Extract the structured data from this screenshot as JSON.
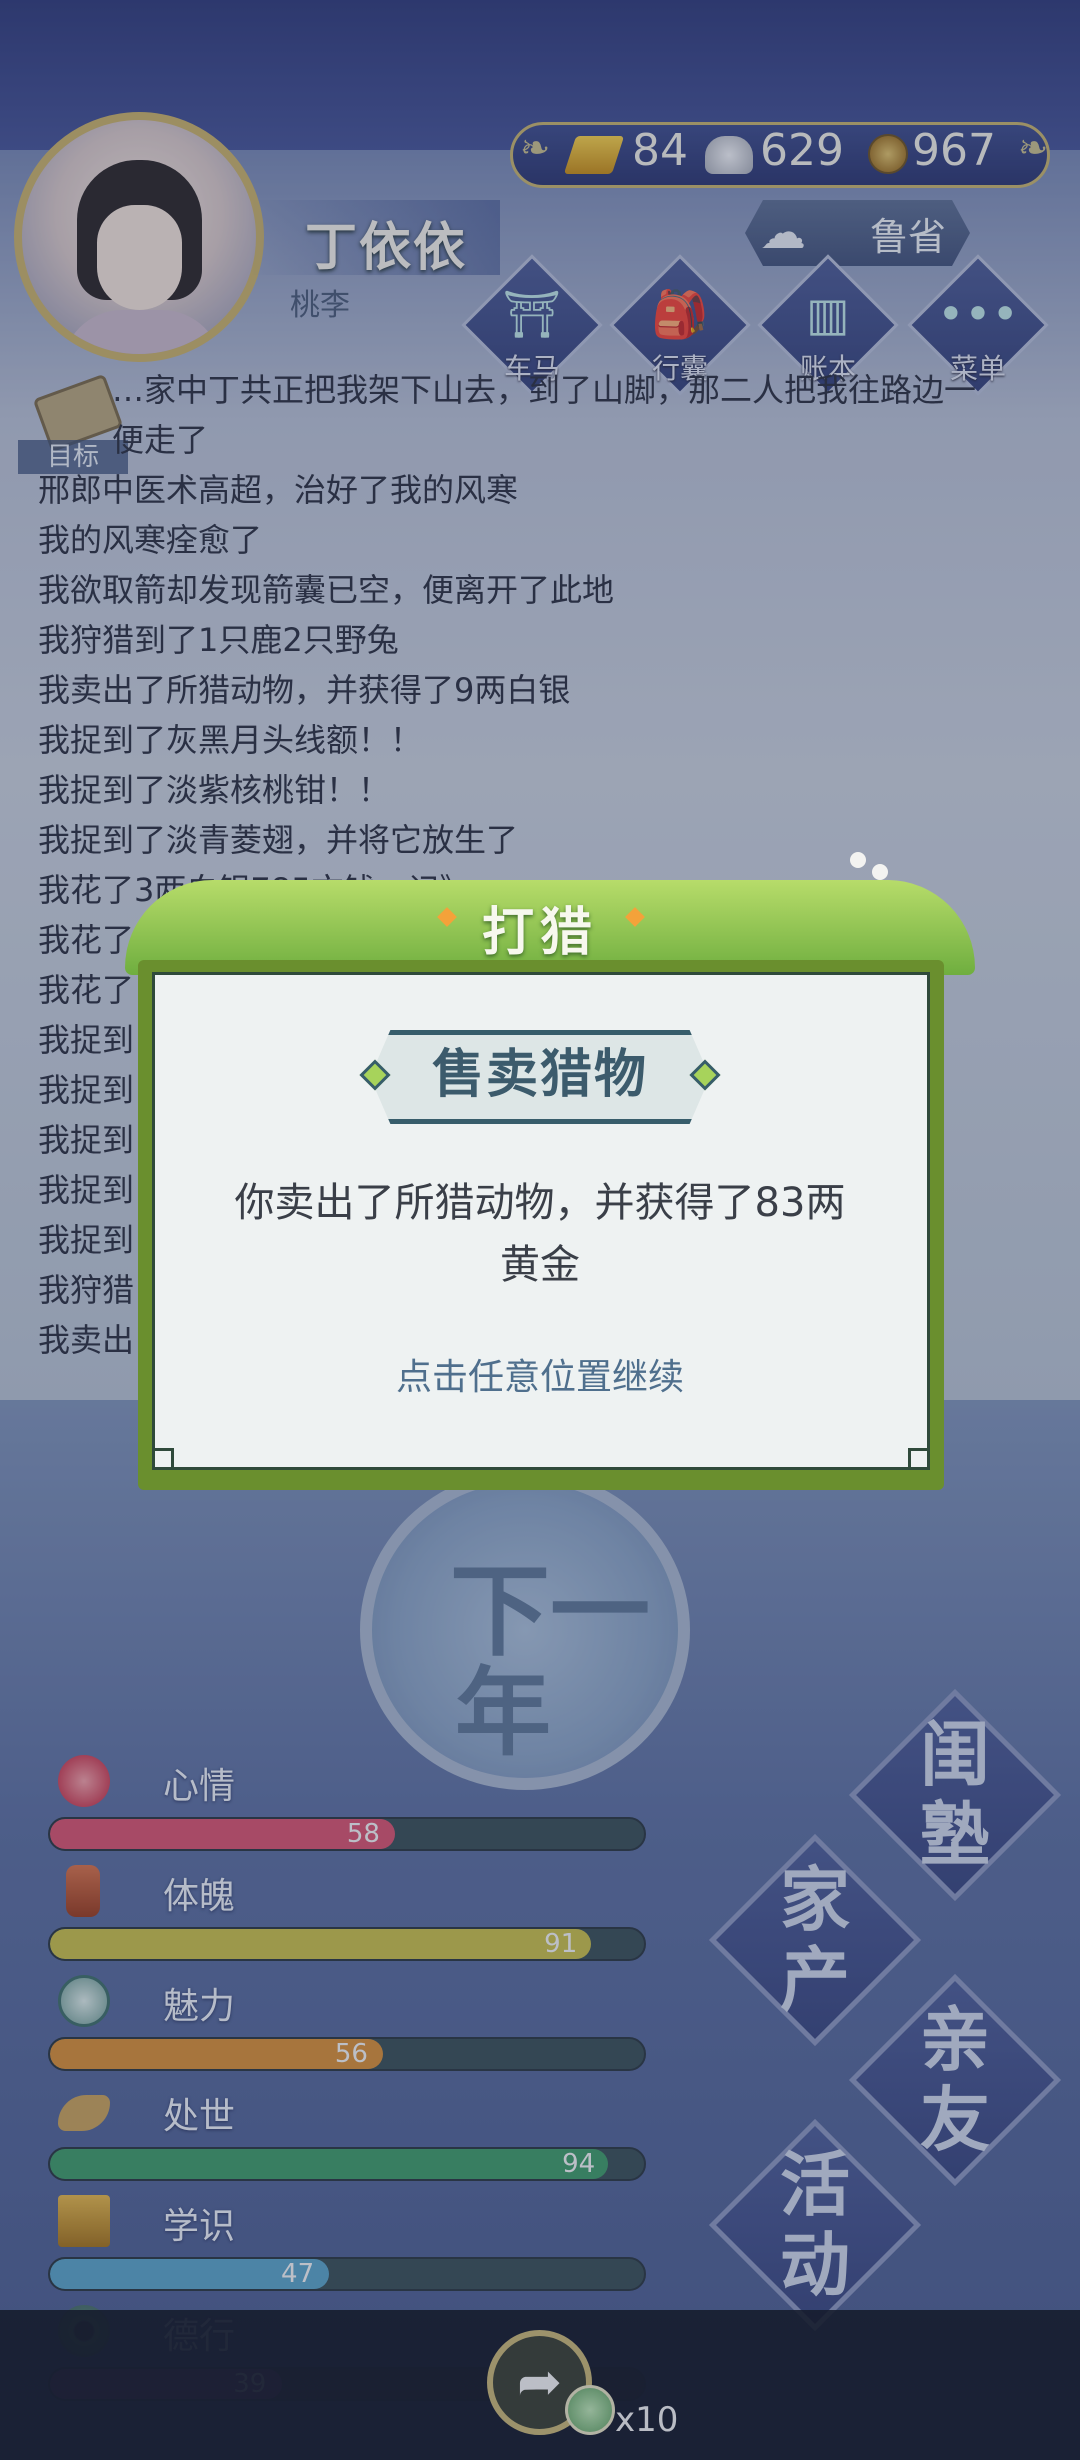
{
  "player": {
    "name": "丁依依",
    "subtitle": "桃李"
  },
  "currency": {
    "gold": "84",
    "silver": "629",
    "coins": "967"
  },
  "reflect_button": {
    "label": "鲁省"
  },
  "top_menu": [
    {
      "label": "车马",
      "icon": "carriage-icon"
    },
    {
      "label": "行囊",
      "icon": "bag-icon"
    },
    {
      "label": "账本",
      "icon": "ledger-icon"
    },
    {
      "label": "菜单",
      "icon": "menu-dots-icon"
    }
  ],
  "target": {
    "label": "目标"
  },
  "event_log": [
    "…家中丁共正把我架下山去，到了山脚，那二人把我往路边一",
    "便走了",
    "邢郎中医术高超，治好了我的风寒",
    "我的风寒痊愈了",
    "我欲取箭却发现箭囊已空，便离开了此地",
    "我狩猎到了1只鹿2只野兔",
    "我卖出了所猎动物，并获得了9两白银",
    "我捉到了灰黑月头线额！！",
    "我捉到了淡紫核桃钳！！",
    "我捉到了淡青菱翅，并将它放生了",
    "我花了3两白银785文钱…记》",
    "我花了",
    "我花了",
    "我捉到",
    "我捉到",
    "我捉到",
    "我捉到",
    "我捉到",
    "我狩猎",
    "我卖出"
  ],
  "next_year": {
    "line1": "下一",
    "line2": "年"
  },
  "stats": [
    {
      "name": "心情",
      "value": 58,
      "max": 100,
      "color": "#d9546f",
      "icon": "flower-icon"
    },
    {
      "name": "体魄",
      "value": 91,
      "max": 100,
      "color": "#c9c04a",
      "icon": "strength-icon"
    },
    {
      "name": "魅力",
      "value": 56,
      "max": 100,
      "color": "#d98f36",
      "icon": "mirror-icon"
    },
    {
      "name": "处世",
      "value": 94,
      "max": 100,
      "color": "#3f9c68",
      "icon": "handshake-icon"
    },
    {
      "name": "学识",
      "value": 47,
      "max": 100,
      "color": "#5aa4c8",
      "icon": "books-icon"
    },
    {
      "name": "德行",
      "value": 39,
      "max": 100,
      "color": "#8a3a8c",
      "icon": "jade-icon"
    }
  ],
  "actions": [
    {
      "label": "闺塾"
    },
    {
      "label": "家产"
    },
    {
      "label": "亲友"
    },
    {
      "label": "活动"
    }
  ],
  "share": {
    "count": "x10"
  },
  "modal": {
    "header": "打猎",
    "title": "售卖猎物",
    "message_line1": "你卖出了所猎动物，并获得了83两",
    "message_line2": "黄金",
    "continue": "点击任意位置继续"
  },
  "colors": {
    "modal_frame": "#6a8f2e",
    "modal_body": "#eef2f2",
    "title_text": "#3c5b6c"
  }
}
